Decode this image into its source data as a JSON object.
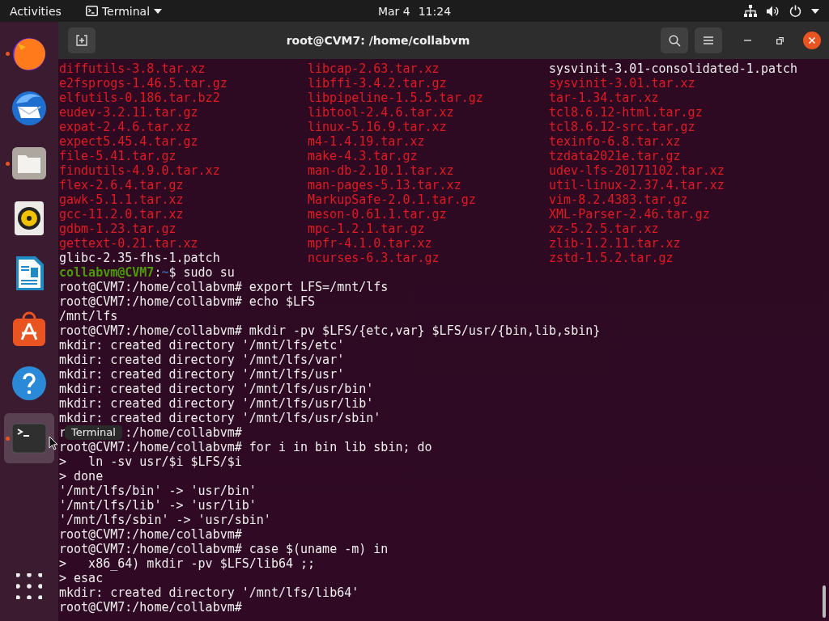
{
  "top_bar": {
    "activities": "Activities",
    "app_menu": "Terminal",
    "date": "Mar 4",
    "time": "11:24"
  },
  "dock": {
    "items": [
      {
        "kind": "fox",
        "running": true,
        "active": false
      },
      {
        "kind": "mail",
        "running": false,
        "active": false
      },
      {
        "kind": "folder",
        "running": true,
        "active": false
      },
      {
        "kind": "speaker",
        "running": false,
        "active": false
      },
      {
        "kind": "document",
        "running": false,
        "active": false
      },
      {
        "kind": "bag",
        "running": false,
        "active": false
      },
      {
        "kind": "help",
        "running": false,
        "active": false
      },
      {
        "kind": "terminal",
        "running": true,
        "active": true
      }
    ],
    "tooltip": "Terminal"
  },
  "window": {
    "title": "root@CVM7: /home/collabvm"
  },
  "terminal": {
    "listing": [
      [
        {
          "name": "diffutils-3.8.tar.xz",
          "archive": true
        },
        {
          "name": "libcap-2.63.tar.xz",
          "archive": true
        },
        {
          "name": "sysvinit-3.01-consolidated-1.patch",
          "archive": false
        }
      ],
      [
        {
          "name": "e2fsprogs-1.46.5.tar.gz",
          "archive": true
        },
        {
          "name": "libffi-3.4.2.tar.gz",
          "archive": true
        },
        {
          "name": "sysvinit-3.01.tar.xz",
          "archive": true
        }
      ],
      [
        {
          "name": "elfutils-0.186.tar.bz2",
          "archive": true
        },
        {
          "name": "libpipeline-1.5.5.tar.gz",
          "archive": true
        },
        {
          "name": "tar-1.34.tar.xz",
          "archive": true
        }
      ],
      [
        {
          "name": "eudev-3.2.11.tar.gz",
          "archive": true
        },
        {
          "name": "libtool-2.4.6.tar.xz",
          "archive": true
        },
        {
          "name": "tcl8.6.12-html.tar.gz",
          "archive": true
        }
      ],
      [
        {
          "name": "expat-2.4.6.tar.xz",
          "archive": true
        },
        {
          "name": "linux-5.16.9.tar.xz",
          "archive": true
        },
        {
          "name": "tcl8.6.12-src.tar.gz",
          "archive": true
        }
      ],
      [
        {
          "name": "expect5.45.4.tar.gz",
          "archive": true
        },
        {
          "name": "m4-1.4.19.tar.xz",
          "archive": true
        },
        {
          "name": "texinfo-6.8.tar.xz",
          "archive": true
        }
      ],
      [
        {
          "name": "file-5.41.tar.gz",
          "archive": true
        },
        {
          "name": "make-4.3.tar.gz",
          "archive": true
        },
        {
          "name": "tzdata2021e.tar.gz",
          "archive": true
        }
      ],
      [
        {
          "name": "findutils-4.9.0.tar.xz",
          "archive": true
        },
        {
          "name": "man-db-2.10.1.tar.xz",
          "archive": true
        },
        {
          "name": "udev-lfs-20171102.tar.xz",
          "archive": true
        }
      ],
      [
        {
          "name": "flex-2.6.4.tar.gz",
          "archive": true
        },
        {
          "name": "man-pages-5.13.tar.xz",
          "archive": true
        },
        {
          "name": "util-linux-2.37.4.tar.xz",
          "archive": true
        }
      ],
      [
        {
          "name": "gawk-5.1.1.tar.xz",
          "archive": true
        },
        {
          "name": "MarkupSafe-2.0.1.tar.gz",
          "archive": true
        },
        {
          "name": "vim-8.2.4383.tar.gz",
          "archive": true
        }
      ],
      [
        {
          "name": "gcc-11.2.0.tar.xz",
          "archive": true
        },
        {
          "name": "meson-0.61.1.tar.gz",
          "archive": true
        },
        {
          "name": "XML-Parser-2.46.tar.gz",
          "archive": true
        }
      ],
      [
        {
          "name": "gdbm-1.23.tar.gz",
          "archive": true
        },
        {
          "name": "mpc-1.2.1.tar.gz",
          "archive": true
        },
        {
          "name": "xz-5.2.5.tar.xz",
          "archive": true
        }
      ],
      [
        {
          "name": "gettext-0.21.tar.xz",
          "archive": true
        },
        {
          "name": "mpfr-4.1.0.tar.xz",
          "archive": true
        },
        {
          "name": "zlib-1.2.11.tar.xz",
          "archive": true
        }
      ],
      [
        {
          "name": "glibc-2.35-fhs-1.patch",
          "archive": false
        },
        {
          "name": "ncurses-6.3.tar.gz",
          "archive": true
        },
        {
          "name": "zstd-1.5.2.tar.gz",
          "archive": true
        }
      ]
    ],
    "lines": [
      {
        "segments": [
          {
            "kind": "user",
            "text": "collabvm@CVM7"
          },
          {
            "kind": "plain",
            "text": ":"
          },
          {
            "kind": "path",
            "text": "~"
          },
          {
            "kind": "plain",
            "text": "$ sudo su"
          }
        ]
      },
      {
        "text": "root@CVM7:/home/collabvm# export LFS=/mnt/lfs"
      },
      {
        "text": "root@CVM7:/home/collabvm# echo $LFS"
      },
      {
        "text": "/mnt/lfs"
      },
      {
        "text": "root@CVM7:/home/collabvm# mkdir -pv $LFS/{etc,var} $LFS/usr/{bin,lib,sbin}"
      },
      {
        "text": "mkdir: created directory '/mnt/lfs/etc'"
      },
      {
        "text": "mkdir: created directory '/mnt/lfs/var'"
      },
      {
        "text": "mkdir: created directory '/mnt/lfs/usr'"
      },
      {
        "text": "mkdir: created directory '/mnt/lfs/usr/bin'"
      },
      {
        "text": "mkdir: created directory '/mnt/lfs/usr/lib'"
      },
      {
        "text": "mkdir: created directory '/mnt/lfs/usr/sbin'"
      },
      {
        "before": "r",
        "after": ":/home/collabvm#"
      },
      {
        "text": "root@CVM7:/home/collabvm# for i in bin lib sbin; do"
      },
      {
        "text": ">   ln -sv usr/$i $LFS/$i"
      },
      {
        "text": "> done"
      },
      {
        "text": "'/mnt/lfs/bin' -> 'usr/bin'"
      },
      {
        "text": "'/mnt/lfs/lib' -> 'usr/lib'"
      },
      {
        "text": "'/mnt/lfs/sbin' -> 'usr/sbin'"
      },
      {
        "text": "root@CVM7:/home/collabvm#"
      },
      {
        "text": "root@CVM7:/home/collabvm# case $(uname -m) in"
      },
      {
        "text": ">   x86_64) mkdir -pv $LFS/lib64 ;;"
      },
      {
        "text": "> esac"
      },
      {
        "text": "mkdir: created directory '/mnt/lfs/lib64'"
      },
      {
        "text": "root@CVM7:/home/collabvm#"
      }
    ]
  }
}
